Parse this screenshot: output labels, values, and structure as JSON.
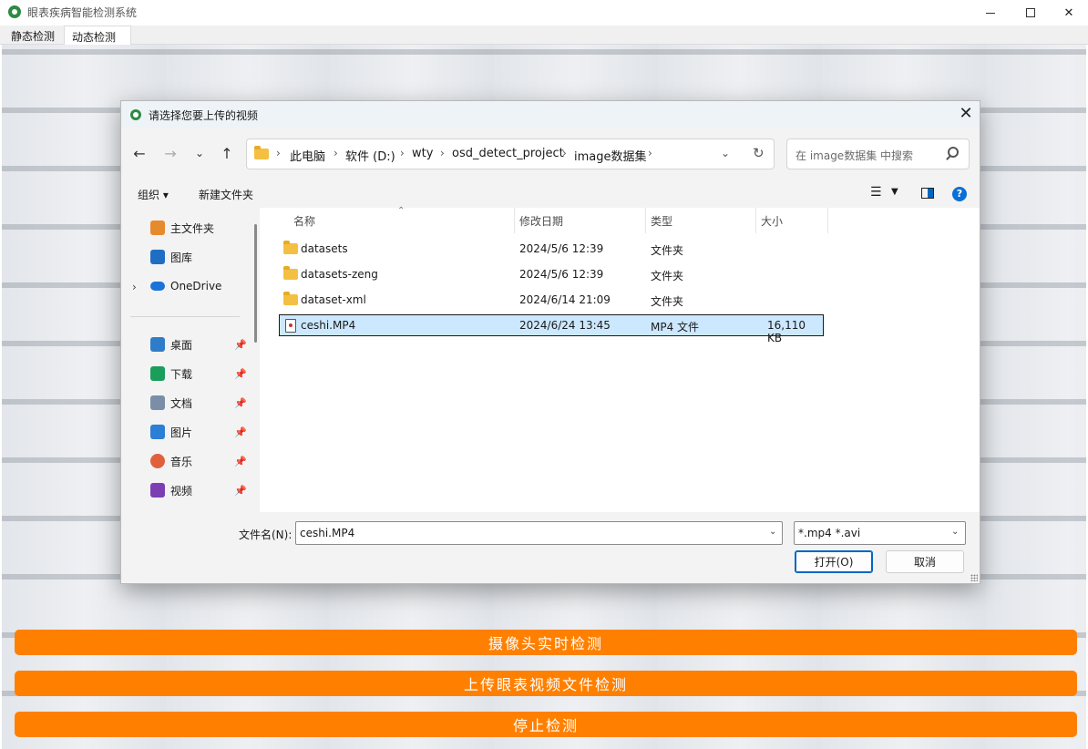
{
  "window": {
    "title": "眼表疾病智能检测系统",
    "tabs": [
      "静态检测",
      "动态检测"
    ],
    "active_tab": "动态检测"
  },
  "dialog": {
    "title": "请选择您要上传的视频",
    "breadcrumb": [
      "此电脑",
      "软件 (D:)",
      "wty",
      "osd_detect_project",
      "image数据集"
    ],
    "search_placeholder": "在 image数据集 中搜索",
    "toolbar": {
      "organize": "组织 ▾",
      "new_folder": "新建文件夹"
    },
    "sidebar": {
      "quick": [
        {
          "label": "主文件夹",
          "icon": "home-icon"
        },
        {
          "label": "图库",
          "icon": "gallery-icon"
        },
        {
          "label": "OneDrive",
          "icon": "cloud-icon"
        }
      ],
      "pinned": [
        {
          "label": "桌面",
          "icon": "desktop-icon"
        },
        {
          "label": "下载",
          "icon": "download-icon"
        },
        {
          "label": "文档",
          "icon": "document-icon"
        },
        {
          "label": "图片",
          "icon": "picture-icon"
        },
        {
          "label": "音乐",
          "icon": "music-icon"
        },
        {
          "label": "视频",
          "icon": "video-icon"
        }
      ]
    },
    "columns": [
      "名称",
      "修改日期",
      "类型",
      "大小"
    ],
    "files": [
      {
        "name": "datasets",
        "date": "2024/5/6 12:39",
        "type": "文件夹",
        "size": ""
      },
      {
        "name": "datasets-zeng",
        "date": "2024/5/6 12:39",
        "type": "文件夹",
        "size": ""
      },
      {
        "name": "dataset-xml",
        "date": "2024/6/14 21:09",
        "type": "文件夹",
        "size": ""
      },
      {
        "name": "ceshi.MP4",
        "date": "2024/6/24 13:45",
        "type": "MP4 文件",
        "size": "16,110 KB"
      }
    ],
    "filename_label": "文件名(N):",
    "filename_value": "ceshi.MP4",
    "filter_value": "*.mp4 *.avi",
    "open_label": "打开(O)",
    "cancel_label": "取消"
  },
  "actions": {
    "camera": "摄像头实时检测",
    "upload": "上传眼表视频文件检测",
    "stop": "停止检测"
  },
  "colors": {
    "accent": "#ff8000",
    "selection": "#cce8ff"
  }
}
